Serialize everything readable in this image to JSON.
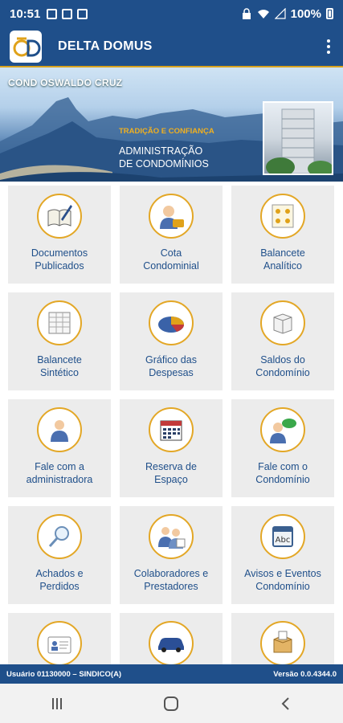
{
  "status_bar": {
    "time": "10:51",
    "battery": "100%"
  },
  "app_bar": {
    "title": "DELTA DOMUS",
    "logo_text": "δD"
  },
  "banner": {
    "cond_name": "COND OSWALDO CRUZ",
    "tagline": "TRADIÇÃO E CONFIANÇA",
    "admin_line1": "ADMINISTRAÇÃO",
    "admin_line2": "DE CONDOMÍNIOS"
  },
  "tiles": [
    {
      "label": "Documentos\nPublicados",
      "icon": "document-pen-icon"
    },
    {
      "label": "Cota\nCondominial",
      "icon": "person-money-icon"
    },
    {
      "label": "Balancete\nAnalítico",
      "icon": "users-sheet-icon"
    },
    {
      "label": "Balancete\nSintético",
      "icon": "spreadsheet-icon"
    },
    {
      "label": "Gráfico das\nDespesas",
      "icon": "pie-chart-icon"
    },
    {
      "label": "Saldos do\nCondomínio",
      "icon": "box-icon"
    },
    {
      "label": "Fale com a\nadministradora",
      "icon": "person-icon"
    },
    {
      "label": "Reserva de\nEspaço",
      "icon": "calendar-icon"
    },
    {
      "label": "Fale com o\nCondomínio",
      "icon": "person-chat-icon"
    },
    {
      "label": "Achados e\nPerdidos",
      "icon": "magnifier-icon"
    },
    {
      "label": "Colaboradores e\nPrestadores",
      "icon": "people-icon"
    },
    {
      "label": "Avisos e Eventos\nCondomínio",
      "icon": "abc-calendar-icon"
    },
    {
      "label": "",
      "icon": "id-card-icon"
    },
    {
      "label": "",
      "icon": "car-icon"
    },
    {
      "label": "",
      "icon": "package-icon"
    }
  ],
  "footer": {
    "user": "Usuário   01130000 – SINDICO(A)",
    "version": "Versão 0.0.4344.0"
  },
  "colors": {
    "primary": "#1f4f8a",
    "accent": "#e3a726",
    "tile_bg": "#ececec"
  }
}
